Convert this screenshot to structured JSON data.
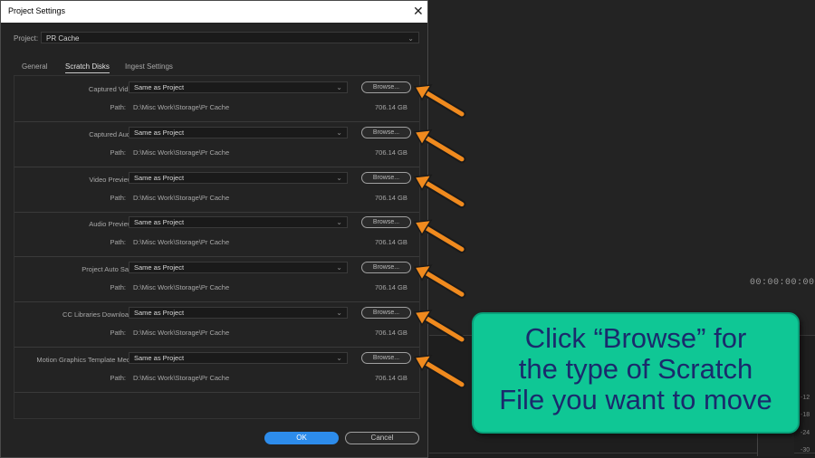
{
  "background": {
    "timecode": "00:00:00:00",
    "meter_ticks": [
      "-12",
      "-18",
      "-24",
      "-30"
    ]
  },
  "dialog": {
    "title": "Project Settings",
    "close_glyph": "✕",
    "project_label": "Project:",
    "project_value": "PR Cache",
    "tabs": [
      {
        "label": "General",
        "active": false
      },
      {
        "label": "Scratch Disks",
        "active": true
      },
      {
        "label": "Ingest Settings",
        "active": false
      }
    ],
    "rows": [
      {
        "label": "Captured Video:",
        "value": "Same as Project",
        "browse": "Browse...",
        "path_label": "Path:",
        "path": "D:\\Misc Work\\Storage\\Pr Cache",
        "size": "706.14 GB"
      },
      {
        "label": "Captured Audio:",
        "value": "Same as Project",
        "browse": "Browse...",
        "path_label": "Path:",
        "path": "D:\\Misc Work\\Storage\\Pr Cache",
        "size": "706.14 GB"
      },
      {
        "label": "Video Previews:",
        "value": "Same as Project",
        "browse": "Browse...",
        "path_label": "Path:",
        "path": "D:\\Misc Work\\Storage\\Pr Cache",
        "size": "706.14 GB"
      },
      {
        "label": "Audio Previews:",
        "value": "Same as Project",
        "browse": "Browse...",
        "path_label": "Path:",
        "path": "D:\\Misc Work\\Storage\\Pr Cache",
        "size": "706.14 GB"
      },
      {
        "label": "Project Auto Save:",
        "value": "Same as Project",
        "browse": "Browse...",
        "path_label": "Path:",
        "path": "D:\\Misc Work\\Storage\\Pr Cache",
        "size": "706.14 GB"
      },
      {
        "label": "CC Libraries Downloads:",
        "value": "Same as Project",
        "browse": "Browse...",
        "path_label": "Path:",
        "path": "D:\\Misc Work\\Storage\\Pr Cache",
        "size": "706.14 GB"
      },
      {
        "label": "Motion Graphics Template Media:",
        "value": "Same as Project",
        "browse": "Browse...",
        "path_label": "Path:",
        "path": "D:\\Misc Work\\Storage\\Pr Cache",
        "size": "706.14 GB"
      }
    ],
    "ok_label": "OK",
    "cancel_label": "Cancel"
  },
  "callout": {
    "lines": [
      "Click “Browse” for",
      "the type of Scratch",
      "File you want to move"
    ],
    "color": "#0fc795"
  },
  "arrow_color": "#f08a1e"
}
